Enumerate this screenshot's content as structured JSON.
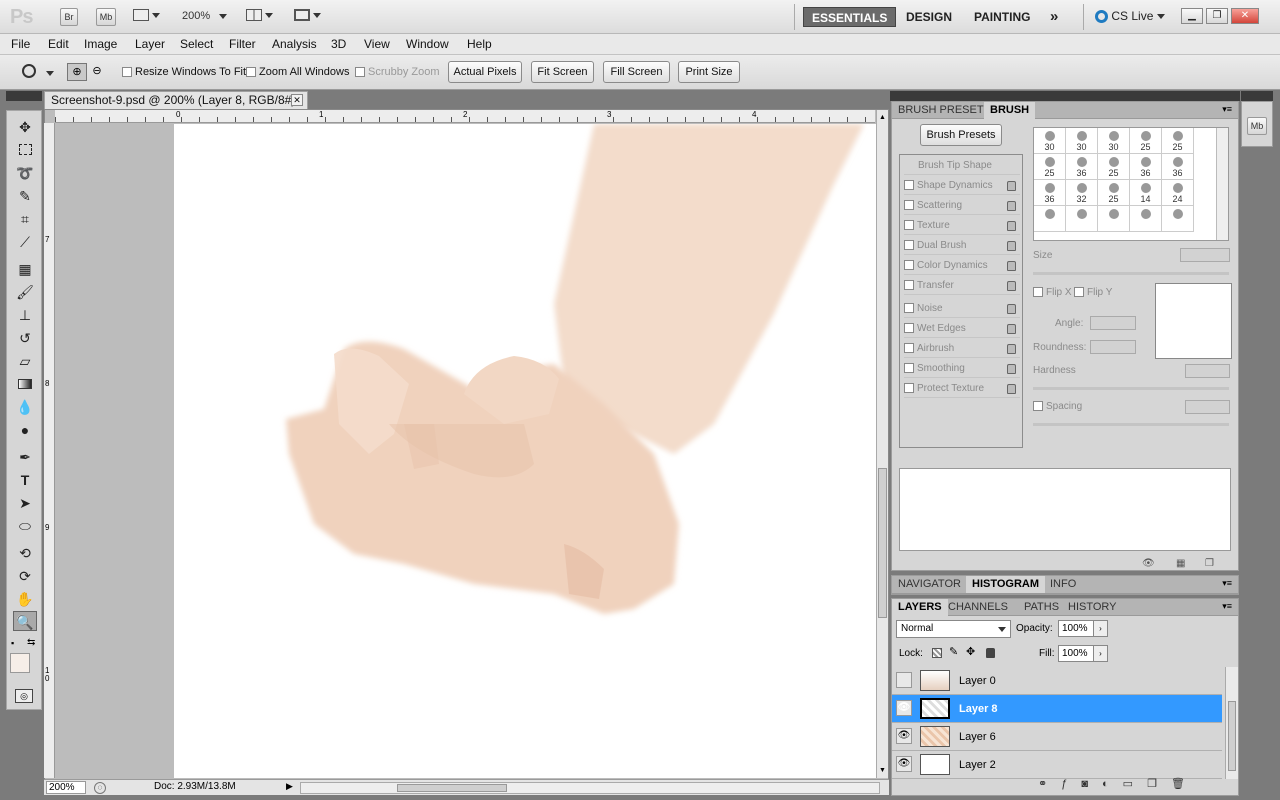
{
  "app": {
    "logo": "Ps",
    "bridge_label": "Br",
    "minibridge_label": "Mb",
    "zoom": "200%",
    "workspaces": [
      "ESSENTIALS",
      "DESIGN",
      "PAINTING"
    ],
    "more_workspaces": "»",
    "cslive": "CS Live"
  },
  "menu": [
    "File",
    "Edit",
    "Image",
    "Layer",
    "Select",
    "Filter",
    "Analysis",
    "3D",
    "View",
    "Window",
    "Help"
  ],
  "options": {
    "resize_windows": "Resize Windows To Fit",
    "zoom_all": "Zoom All Windows",
    "scrubby_zoom": "Scrubby Zoom",
    "actual_pixels": "Actual Pixels",
    "fit_screen": "Fit Screen",
    "fill_screen": "Fill Screen",
    "print_size": "Print Size"
  },
  "document": {
    "tab_title": "Screenshot-9.psd @ 200% (Layer 8, RGB/8#) *",
    "ruler_top": [
      "0",
      "1",
      "2",
      "3",
      "4"
    ],
    "ruler_left": [
      "7",
      "8",
      "9",
      "1 0"
    ],
    "status_zoom": "200%",
    "status_doc": "Doc: 2.93M/13.8M"
  },
  "brush_panel": {
    "tabs": [
      "BRUSH PRESETS",
      "BRUSH"
    ],
    "presets_button": "Brush Presets",
    "options": [
      "Brush Tip Shape",
      "Shape Dynamics",
      "Scattering",
      "Texture",
      "Dual Brush",
      "Color Dynamics",
      "Transfer",
      "Noise",
      "Wet Edges",
      "Airbrush",
      "Smoothing",
      "Protect Texture"
    ],
    "sizes": [
      "30",
      "30",
      "30",
      "25",
      "25",
      "25",
      "36",
      "25",
      "36",
      "36",
      "36",
      "32",
      "25",
      "14",
      "24",
      "",
      "",
      "",
      "",
      ""
    ],
    "size_label": "Size",
    "flip_x": "Flip X",
    "flip_y": "Flip Y",
    "angle": "Angle:",
    "roundness": "Roundness:",
    "hardness": "Hardness",
    "spacing": "Spacing"
  },
  "nav_panel": {
    "tabs": [
      "NAVIGATOR",
      "HISTOGRAM",
      "INFO"
    ]
  },
  "layers_panel": {
    "tabs": [
      "LAYERS",
      "CHANNELS",
      "PATHS",
      "HISTORY"
    ],
    "blend_mode": "Normal",
    "opacity_label": "Opacity:",
    "opacity": "100%",
    "lock_label": "Lock:",
    "fill_label": "Fill:",
    "fill": "100%",
    "layers": [
      {
        "name": "Layer 0",
        "visible": false,
        "selected": false
      },
      {
        "name": "Layer 8",
        "visible": true,
        "selected": true
      },
      {
        "name": "Layer 6",
        "visible": true,
        "selected": false
      },
      {
        "name": "Layer 2",
        "visible": true,
        "selected": false
      }
    ]
  },
  "colors": {
    "selection": "#3399ff",
    "skin": "#f1d7c3",
    "workspace_active": "#6b6b6b"
  }
}
